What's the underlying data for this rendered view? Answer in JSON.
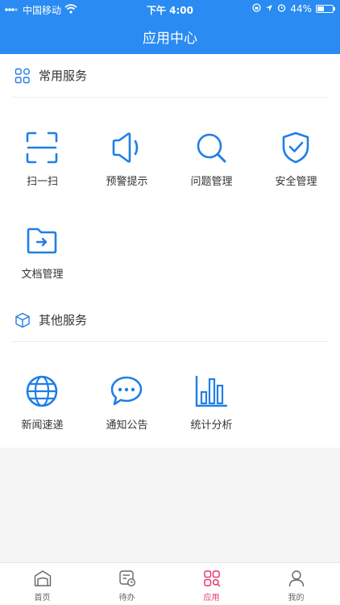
{
  "status_bar": {
    "carrier": "中国移动",
    "time": "下午 4:00",
    "battery": "44%",
    "battery_level": 0.44
  },
  "header": {
    "title": "应用中心"
  },
  "sections": [
    {
      "title": "常用服务",
      "items": [
        {
          "label": "扫一扫",
          "icon": "scan-icon"
        },
        {
          "label": "预警提示",
          "icon": "speaker-icon"
        },
        {
          "label": "问题管理",
          "icon": "search-icon"
        },
        {
          "label": "安全管理",
          "icon": "shield-icon"
        },
        {
          "label": "文档管理",
          "icon": "folder-icon"
        }
      ]
    },
    {
      "title": "其他服务",
      "items": [
        {
          "label": "新闻速递",
          "icon": "globe-icon"
        },
        {
          "label": "通知公告",
          "icon": "chat-icon"
        },
        {
          "label": "统计分析",
          "icon": "bar-chart-icon"
        }
      ]
    }
  ],
  "tabbar": {
    "items": [
      {
        "label": "首页",
        "icon": "home-icon"
      },
      {
        "label": "待办",
        "icon": "todo-icon"
      },
      {
        "label": "应用",
        "icon": "apps-icon",
        "active": true
      },
      {
        "label": "我的",
        "icon": "user-icon"
      }
    ]
  },
  "colors": {
    "primary": "#2a8bf2",
    "active_tab": "#e8396b",
    "icon": "#1f7fe6"
  }
}
